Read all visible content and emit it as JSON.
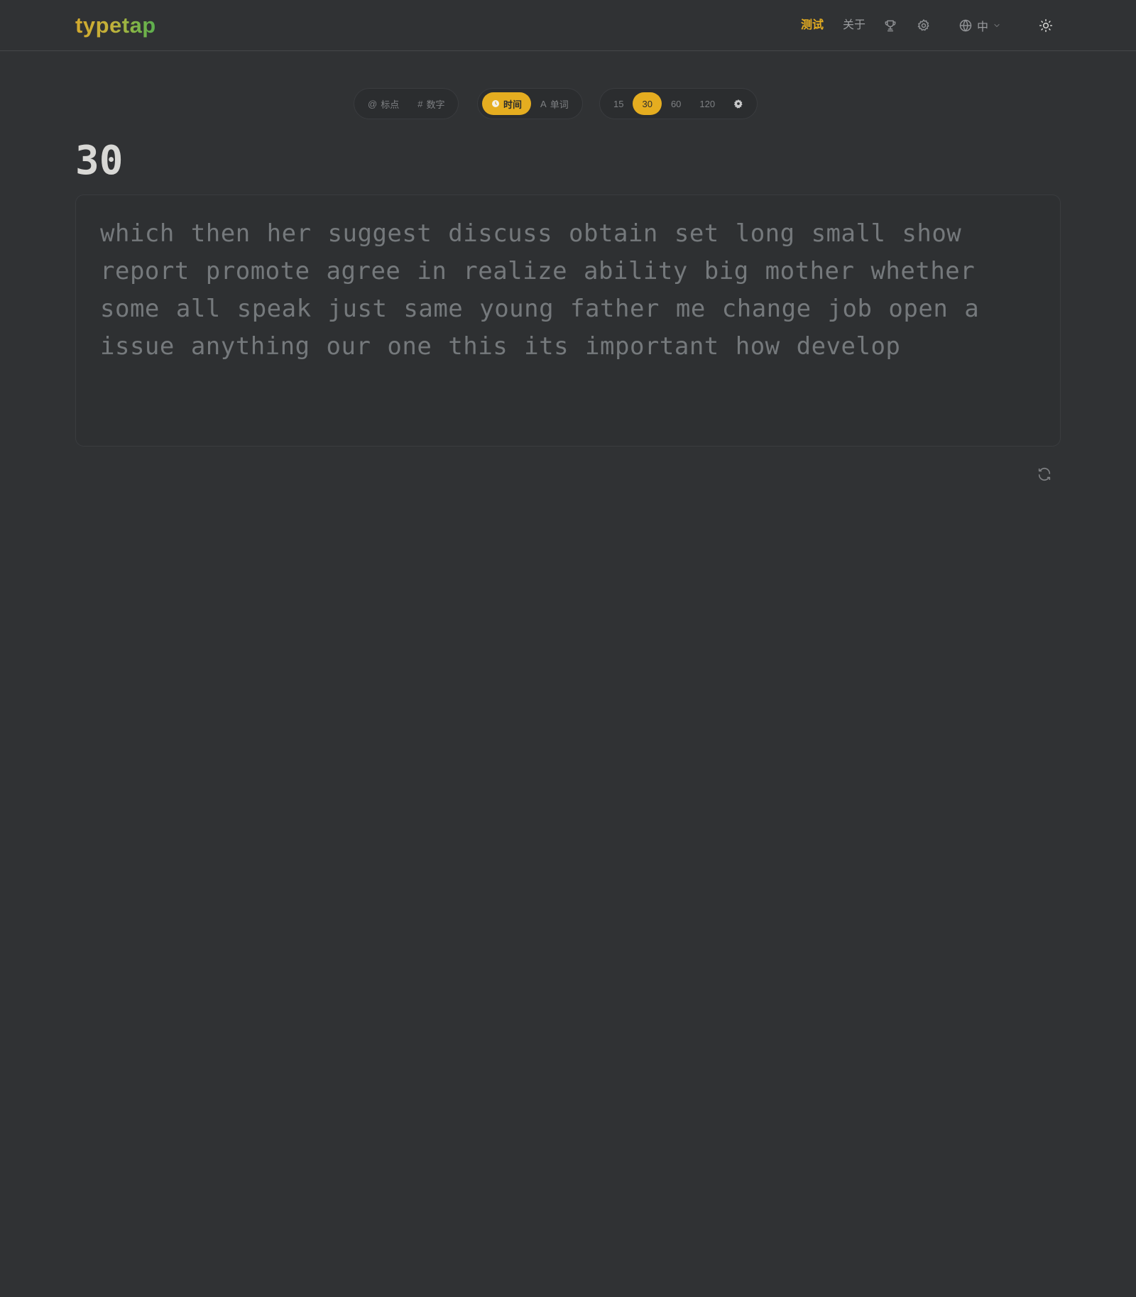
{
  "app": {
    "logo": "typetap"
  },
  "nav": {
    "test": "测试",
    "about": "关于",
    "language": "中",
    "icons": {
      "leaderboard": "trophy-icon",
      "settings": "gear-icon",
      "language": "globe-icon",
      "theme": "sun-icon"
    }
  },
  "toolbar": {
    "punctuation": {
      "symbol": "@",
      "label": "标点"
    },
    "numbers": {
      "symbol": "#",
      "label": "数字"
    },
    "mode_time": {
      "label": "时间",
      "selected": true
    },
    "mode_words": {
      "symbol": "A",
      "label": "单词",
      "selected": false
    },
    "durations": [
      "15",
      "30",
      "60",
      "120"
    ],
    "selected_duration": "30",
    "custom_icon": "gear-icon"
  },
  "timer": "30",
  "words": "which then her suggest discuss obtain set long small show report promote agree in realize ability big mother whether some all speak just same young father me change job open a issue anything our one this its important how develop",
  "restart_icon": "refresh-icon",
  "colors": {
    "background": "#303234",
    "accent": "#e5ad20",
    "text_muted": "#75797c",
    "timer": "#d8d8d5"
  }
}
